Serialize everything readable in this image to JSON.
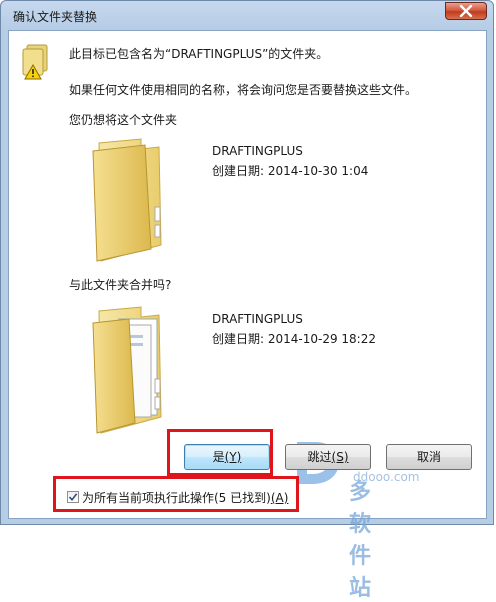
{
  "window": {
    "title": "确认文件夹替换"
  },
  "message": {
    "line1": "此目标已包含名为“DRAFTINGPLUS”的文件夹。",
    "line2": "如果任何文件使用相同的名称，将会询问您是否要替换这些文件。",
    "line3": "您仍想将这个文件夹"
  },
  "target_folder": {
    "name": "DRAFTINGPLUS",
    "date": "创建日期: 2014-10-30 1:04"
  },
  "merge_question": "与此文件夹合并吗?",
  "source_folder": {
    "name": "DRAFTINGPLUS",
    "date": "创建日期: 2014-10-29 18:22"
  },
  "buttons": {
    "yes": {
      "label": "是",
      "key": "(Y)"
    },
    "skip": {
      "label": "跳过",
      "key": "(S)"
    },
    "cancel": {
      "label": "取消"
    }
  },
  "apply_all": {
    "label": "为所有当前项执行此操作(5 已找到)",
    "key": "(A)",
    "checked": true
  },
  "watermark": {
    "text": "多多软件站",
    "url": "ddooo.com"
  }
}
